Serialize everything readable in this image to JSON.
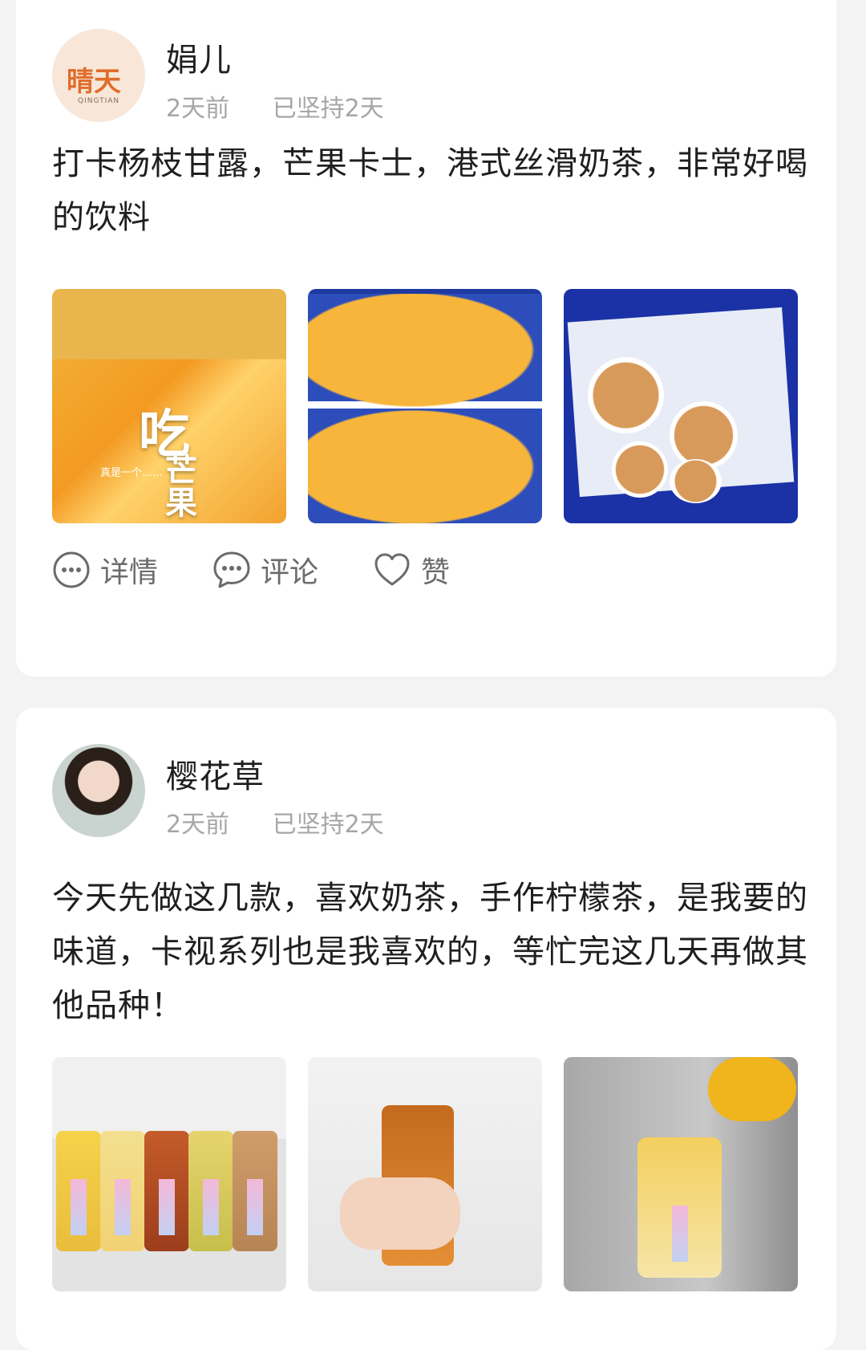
{
  "posts": [
    {
      "name": "娟儿",
      "time": "2天前",
      "streak": "已坚持2天",
      "avatar_text": "晴天",
      "avatar_sub": "QINGTIAN",
      "text": "打卡杨枝甘露，芒果卡士，港式丝滑奶茶，非常好喝的饮料",
      "image1_text_big": "吃",
      "image1_text_vertical": "芒果",
      "image1_text_small": "真是一个……"
    },
    {
      "name": "樱花草",
      "time": "2天前",
      "streak": "已坚持2天",
      "text": "今天先做这几款，喜欢奶茶，手作柠檬茶，是我要的味道，卡视系列也是我喜欢的，等忙完这几天再做其他品种！"
    }
  ],
  "actions": {
    "detail": "详情",
    "comment": "评论",
    "like": "赞"
  },
  "colors": {
    "page_bg": "#f3f3f3",
    "card_bg": "#ffffff",
    "meta_text": "#a6a6a6",
    "action_text": "#6b6b6b"
  },
  "icons": [
    "more-dots-icon",
    "comment-dots-icon",
    "heart-icon"
  ]
}
